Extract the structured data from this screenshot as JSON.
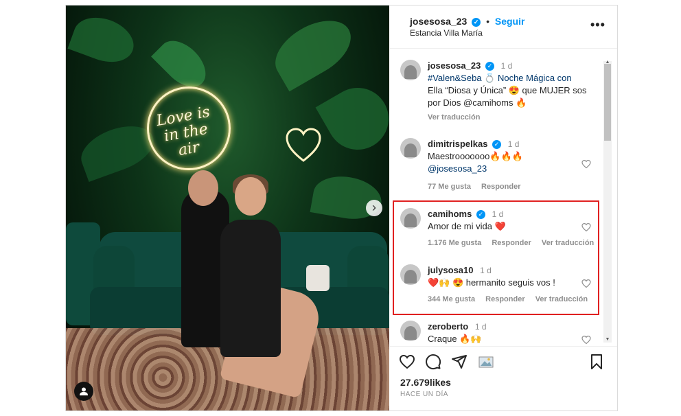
{
  "header": {
    "username": "josesosa_23",
    "separator": "•",
    "follow_label": "Seguir",
    "location": "Estancia Villa María",
    "more_label": "•••"
  },
  "media": {
    "neon_text": "Love is in the air",
    "next_label": "›",
    "tag_label": "👤"
  },
  "caption": {
    "username": "josesosa_23",
    "time": "1 d",
    "line1": "#Valen&Seba 💍 Noche Mágica con",
    "line2": "Ella “Diosa y Única” 😍 que MUJER sos",
    "line3": "por Dios @camihoms 🔥",
    "translate": "Ver traducción"
  },
  "comments": [
    {
      "username": "dimitrispelkas",
      "time": "1 d",
      "line1": "Maestrooooooo🔥🔥🔥",
      "line2": "@josesosa_23",
      "likes": "77 Me gusta",
      "reply": "Responder",
      "translate": ""
    },
    {
      "username": "camihoms",
      "time": "1 d",
      "line1": "Amor de mi vida ❤️",
      "line2": "",
      "likes": "1.176 Me gusta",
      "reply": "Responder",
      "translate": "Ver traducción"
    },
    {
      "username": "julysosa10",
      "time": "1 d",
      "line1": "❤️🙌 😍 hermanito seguis vos !",
      "line2": "",
      "likes": "344 Me gusta",
      "reply": "Responder",
      "translate": "Ver traducción"
    },
    {
      "username": "zeroberto",
      "time": "1 d",
      "line1": "Craque 🔥🙌",
      "line2": "",
      "likes": "",
      "reply": "",
      "translate": ""
    }
  ],
  "footer": {
    "likes": "27.679likes",
    "when": "HACE UN DÍA"
  },
  "colors": {
    "accent": "#0095f6",
    "highlight": "#e02020"
  },
  "icons": [
    "heart-icon",
    "comment-icon",
    "share-icon",
    "gift-icon",
    "bookmark-icon",
    "verified-icon",
    "more-icon"
  ]
}
